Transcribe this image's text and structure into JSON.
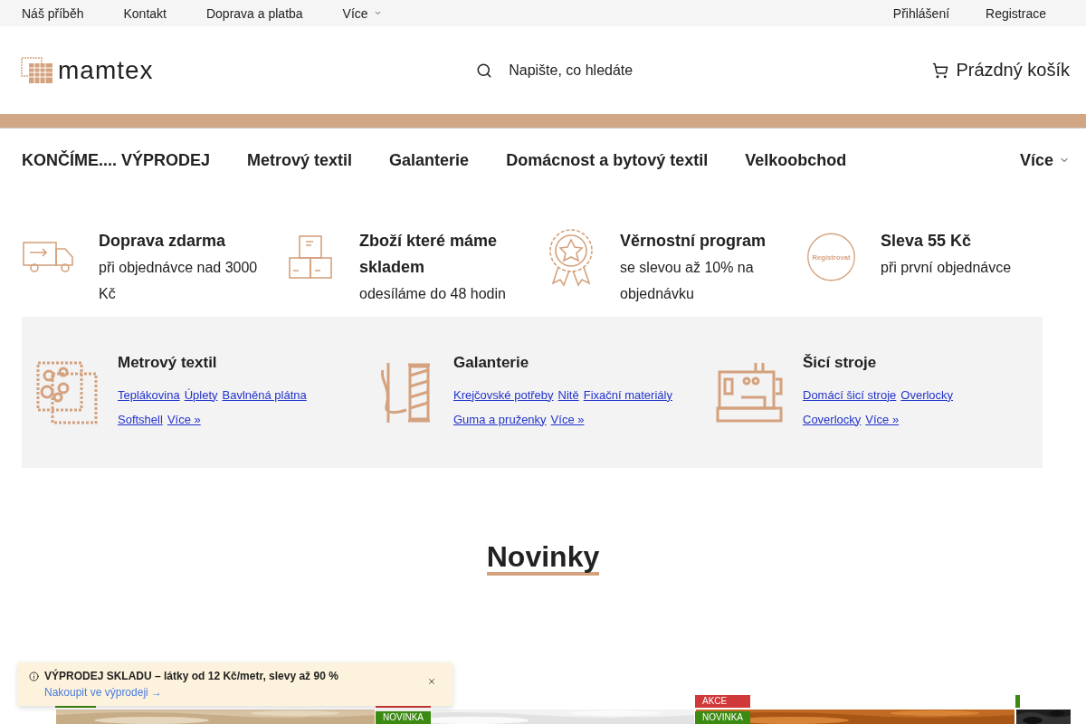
{
  "top_bar": {
    "links": [
      "Náš příběh",
      "Kontakt",
      "Doprava a platba",
      "Více"
    ],
    "account": [
      "Přihlášení",
      "Registrace"
    ]
  },
  "header": {
    "logo": "mamtex",
    "search": {
      "placeholder": "Napište, co hledáte"
    },
    "cart": "Prázdný košík"
  },
  "menu": {
    "items": [
      "KONČÍME.... VÝPRODEJ",
      "Metrový textil",
      "Galanterie",
      "Domácnost a bytový textil",
      "Velkoobchod"
    ],
    "more": "Více"
  },
  "benefits": [
    {
      "kind": "truck",
      "title": "Doprava zdarma",
      "text": "při objednávce nad 3000 Kč"
    },
    {
      "kind": "boxes",
      "title": "Zboží které máme skladem",
      "text": "odesíláme do 48 hodin"
    },
    {
      "kind": "award",
      "title": "Věrnostní program",
      "text": "se slevou až 10% na objednávku"
    },
    {
      "kind": "register",
      "badge": "Registrovat",
      "title": "Sleva 55 Kč",
      "text": "při první objednávce"
    }
  ],
  "categories": [
    {
      "kind": "fabric",
      "title": "Metrový textil",
      "link_rows": [
        [
          "Teplákovina",
          "Úplety",
          "Bavlněná plátna"
        ],
        [
          "Softshell",
          "Více »"
        ]
      ]
    },
    {
      "kind": "thread",
      "title": "Galanterie",
      "link_rows": [
        [
          "Krejčovské potřeby",
          "Nitě",
          "Fixační materiály"
        ],
        [
          "Guma a pruženky",
          "Více »"
        ]
      ]
    },
    {
      "kind": "machine",
      "title": "Šicí stroje",
      "link_rows": [
        [
          "Domácí šicí stroje",
          "Overlocky"
        ],
        [
          "Coverlocky",
          "Více »"
        ]
      ]
    }
  ],
  "section_title": "Novinky",
  "products": [
    {
      "badges": [
        {
          "kind": "novinka"
        }
      ]
    },
    {
      "badges": [
        {
          "kind": "akce"
        },
        {
          "kind": "novinka",
          "label": "NOVINKA"
        }
      ]
    },
    {
      "badges": [
        {
          "kind": "akce",
          "label": "AKCE"
        },
        {
          "kind": "novinka",
          "label": "NOVINKA"
        }
      ]
    },
    {
      "badges": [
        {
          "kind": "novinka"
        }
      ]
    }
  ],
  "notice": {
    "text": "**VÝPRODEJ SKLADU – látky od 12 Kč/metr, slevy až 90 %**",
    "link": "Nakoupit ve výprodeji →"
  }
}
